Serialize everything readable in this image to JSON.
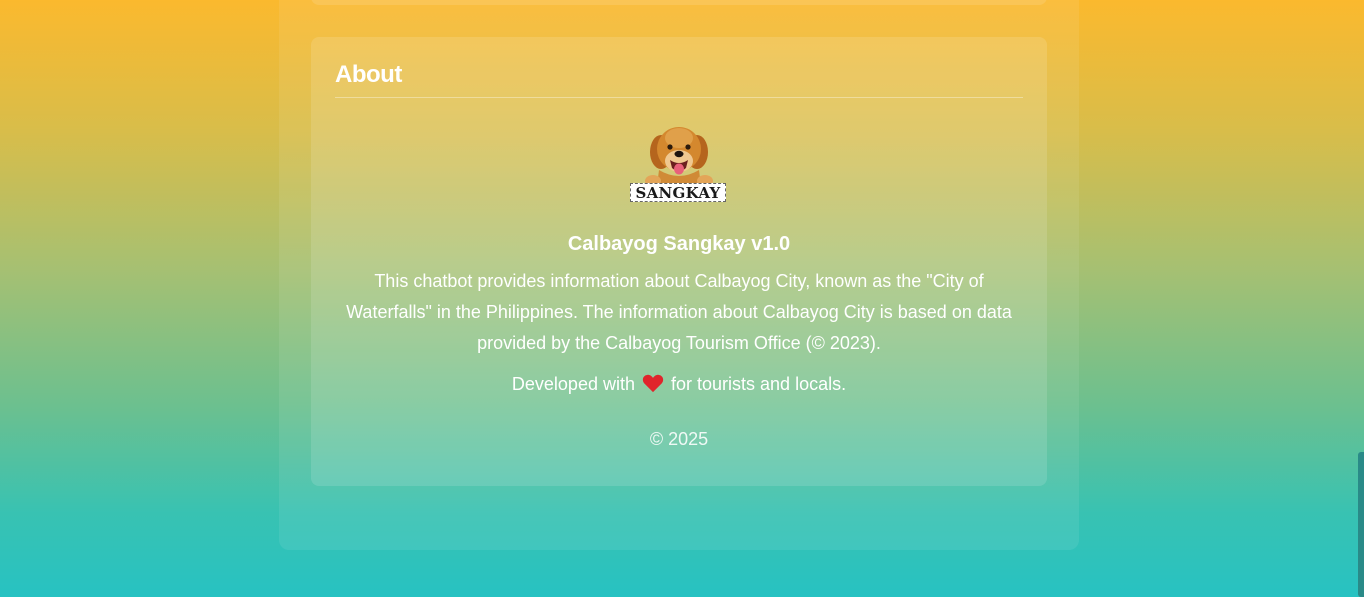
{
  "about": {
    "heading": "About",
    "logo_label": "SANGKAY",
    "app_title": "Calbayog Sangkay v1.0",
    "description": "This chatbot provides information about Calbayog City, known as the \"City of Waterfalls\" in the Philippines. The information about Calbayog City is based on data provided by the Calbayog Tourism Office (© 2023).",
    "developed_prefix": "Developed with",
    "developed_suffix": "for tourists and locals.",
    "heart_icon": "heart-icon",
    "copyright": "© 2025"
  },
  "colors": {
    "gradient_top": "#fbb92e",
    "gradient_bottom": "#27c2c2",
    "heart": "#e0242b",
    "text": "#ffffff"
  }
}
